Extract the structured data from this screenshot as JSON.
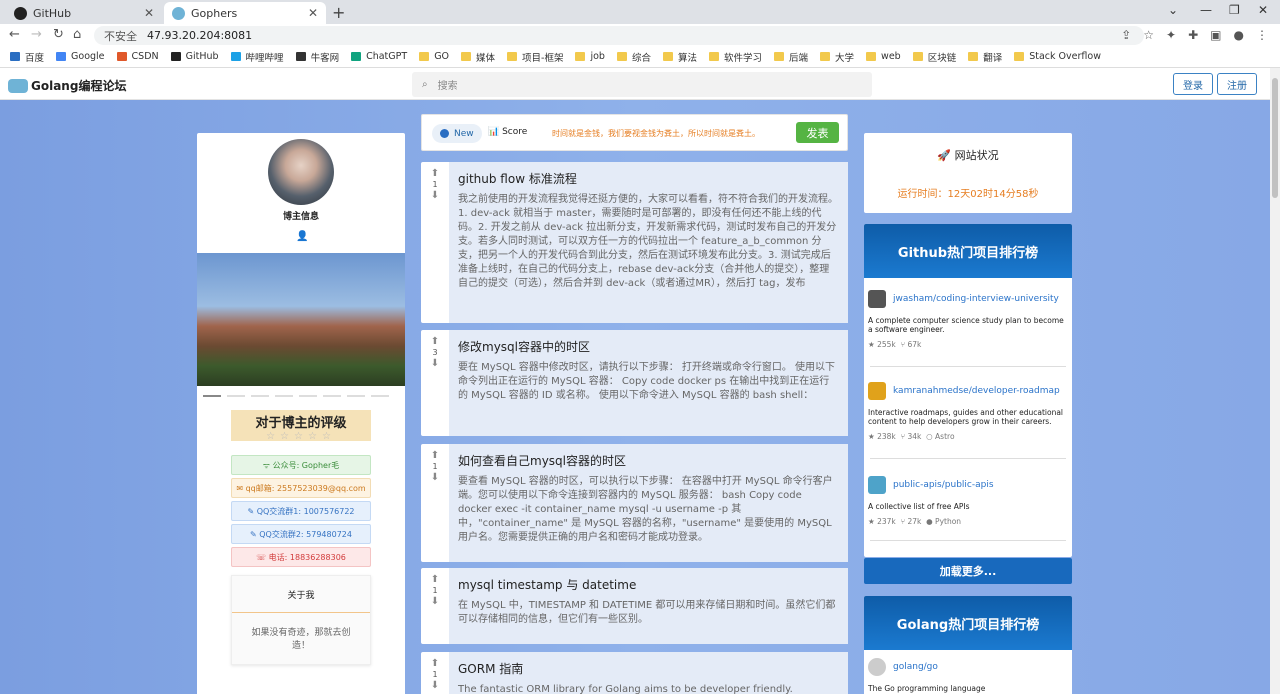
{
  "browser": {
    "tabs": [
      {
        "title": "GitHub",
        "active": false
      },
      {
        "title": "Gophers",
        "active": true
      }
    ],
    "insecure": "不安全",
    "url": "47.93.20.204:8081",
    "bookmarks": [
      "百度",
      "Google",
      "CSDN",
      "GitHub",
      "哔哩哔哩",
      "牛客网",
      "ChatGPT",
      "GO",
      "媒体",
      "项目-框架",
      "job",
      "综合",
      "算法",
      "软件学习",
      "后端",
      "大学",
      "web",
      "区块链",
      "翻译",
      "Stack Overflow"
    ]
  },
  "header": {
    "logo": "Golang编程论坛",
    "search_placeholder": "搜索",
    "login": "登录",
    "register": "注册"
  },
  "sidebar": {
    "blogger": "博主信息",
    "rating_title": "对于博主的评级",
    "stars": "☆☆☆☆☆",
    "contacts": [
      "ᯤ 公众号: Gopher毛",
      "✉ qq邮箱: 2557523039@qq.com",
      "✎ QQ交流群1: 1007576722",
      "✎ QQ交流群2: 579480724",
      "☏ 电话: 18836288306"
    ],
    "about_title": "关于我",
    "about_text": "如果没有奇迹，那就去创造！"
  },
  "feed": {
    "tab_new": "New",
    "tab_score": "Score",
    "motto": "时间就是金钱，我们要视金钱为粪土，所以时间就是粪土。",
    "post_button": "发表",
    "posts": [
      {
        "votes": "1",
        "title": "github flow 标准流程",
        "excerpt": "我之前使用的开发流程我觉得还挺方便的，大家可以看看，符不符合我们的开发流程。1. dev-ack 就相当于 master，需要随时是可部署的，即没有任何还不能上线的代码。2. 开发之前从 dev-ack 拉出新分支，开发新需求代码，测试时发布自己的开发分支。若多人同时测试，可以双方任一方的代码拉出一个 feature_a_b_common 分支，把另一个人的开发代码合到此分支，然后在测试环境发布此分支。3. 测试完成后准备上线时，在自己的代码分支上，rebase dev-ack分支（合并他人的提交），整理自己的提交（可选），然后合并到 dev-ack（或者通过MR），然后打 tag，发布"
      },
      {
        "votes": "3",
        "title": "修改mysql容器中的时区",
        "excerpt": "要在 MySQL 容器中修改时区，请执行以下步骤： 打开终端或命令行窗口。 使用以下命令列出正在运行的 MySQL 容器： Copy code docker ps 在输出中找到正在运行的 MySQL 容器的 ID 或名称。 使用以下命令进入 MySQL 容器的 bash shell："
      },
      {
        "votes": "1",
        "title": "如何查看自己mysql容器的时区",
        "excerpt": "要查看 MySQL 容器的时区，可以执行以下步骤： 在容器中打开 MySQL 命令行客户端。您可以使用以下命令连接到容器内的 MySQL 服务器： bash Copy code docker exec -it container_name mysql -u username -p 其中，\"container_name\" 是 MySQL 容器的名称，\"username\" 是要使用的 MySQL 用户名。您需要提供正确的用户名和密码才能成功登录。"
      },
      {
        "votes": "1",
        "title": "mysql timestamp 与 datetime",
        "excerpt": "在 MySQL 中，TIMESTAMP 和 DATETIME 都可以用来存储日期和时间。虽然它们都可以存储相同的信息，但它们有一些区别。"
      },
      {
        "votes": "1",
        "title": "GORM 指南",
        "excerpt": "The fantastic ORM library for Golang aims to be developer friendly."
      }
    ]
  },
  "right": {
    "status_title": "网站状况",
    "uptime": "运行时间：12天02时14分58秒",
    "github_title": "Github热门项目排行榜",
    "github_repos": [
      {
        "name": "jwasham/coding-interview-university",
        "desc": "A complete computer science study plan to become a software engineer.",
        "stars": "★ 255k",
        "forks": "⑂ 67k",
        "lang": "",
        "color": "#555"
      },
      {
        "name": "kamranahmedse/developer-roadmap",
        "desc": "Interactive roadmaps, guides and other educational content to help developers grow in their careers.",
        "stars": "★ 238k",
        "forks": "⑂ 34k",
        "lang": "○ Astro",
        "color": "#e0a21b"
      },
      {
        "name": "public-apis/public-apis",
        "desc": "A collective list of free APIs",
        "stars": "★ 237k",
        "forks": "⑂ 27k",
        "lang": "● Python",
        "color": "#4ea3c9"
      }
    ],
    "load_more": "加载更多...",
    "golang_title": "Golang热门项目排行榜",
    "golang_repos": [
      {
        "name": "golang/go",
        "desc": "The Go programming language"
      }
    ]
  }
}
